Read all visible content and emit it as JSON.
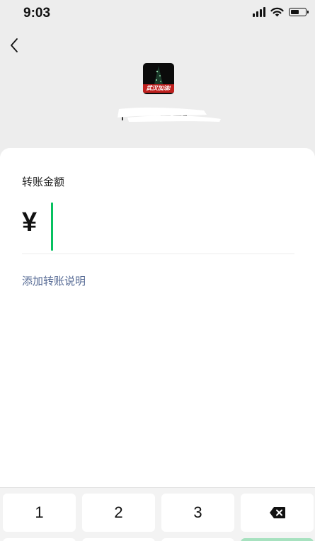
{
  "status_bar": {
    "time": "9:03",
    "icons": [
      "signal-icon",
      "wifi-icon",
      "battery-icon"
    ]
  },
  "header": {
    "back_icon": "chevron-left-icon",
    "avatar_badge_text": "武汉加油!"
  },
  "form": {
    "amount_label": "转账金额",
    "currency_symbol": "¥",
    "amount_value": "",
    "add_note_label": "添加转账说明"
  },
  "keypad": {
    "keys": [
      "1",
      "2",
      "3"
    ],
    "delete_icon": "backspace-icon"
  },
  "colors": {
    "accent": "#07c160",
    "link": "#576b95",
    "confirm_disabled": "#a7e1bf",
    "background": "#ededed"
  }
}
